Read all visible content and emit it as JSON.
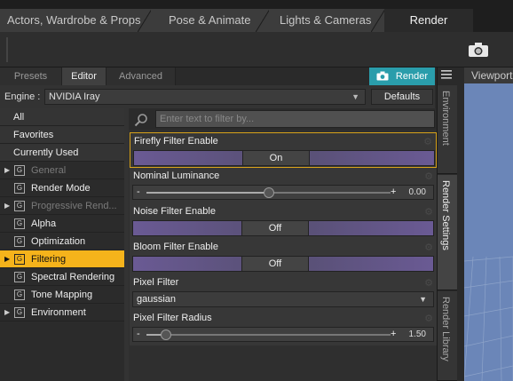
{
  "top_tabs": [
    "Actors, Wardrobe & Props",
    "Pose & Animate",
    "Lights & Cameras",
    "Render"
  ],
  "panel_tabs": [
    "Presets",
    "Editor",
    "Advanced"
  ],
  "render_button": "Render",
  "engine": {
    "label": "Engine :",
    "value": "NVIDIA Iray",
    "defaults_label": "Defaults"
  },
  "categories": {
    "plain": [
      "All",
      "Favorites",
      "Currently Used"
    ],
    "groups": [
      "General",
      "Render Mode",
      "Progressive Rend...",
      "Alpha",
      "Optimization",
      "Filtering",
      "Spectral Rendering",
      "Tone Mapping",
      "Environment"
    ],
    "group_icon_letter": "G",
    "selected": "Filtering",
    "selected_color": "#f5b31b"
  },
  "filter_placeholder": "Enter text to filter by...",
  "properties": [
    {
      "name": "Firefly Filter Enable",
      "type": "toggle",
      "value": "On"
    },
    {
      "name": "Nominal Luminance",
      "type": "slider",
      "value": "0.00",
      "minus": "-",
      "plus": "+",
      "fraction": 0.5
    },
    {
      "name": "Noise Filter Enable",
      "type": "toggle",
      "value": "Off"
    },
    {
      "name": "Bloom Filter Enable",
      "type": "toggle",
      "value": "Off"
    },
    {
      "name": "Pixel Filter",
      "type": "dropdown",
      "value": "gaussian"
    },
    {
      "name": "Pixel Filter Radius",
      "type": "slider",
      "value": "1.50",
      "minus": "-",
      "plus": "+",
      "fraction": 0.08
    }
  ],
  "vertical_tabs": [
    "Environment",
    "Render Settings",
    "Render Library"
  ],
  "viewport_tab": "Viewport",
  "accent_color": "#2a9dab",
  "highlight_color": "#d8a21a"
}
